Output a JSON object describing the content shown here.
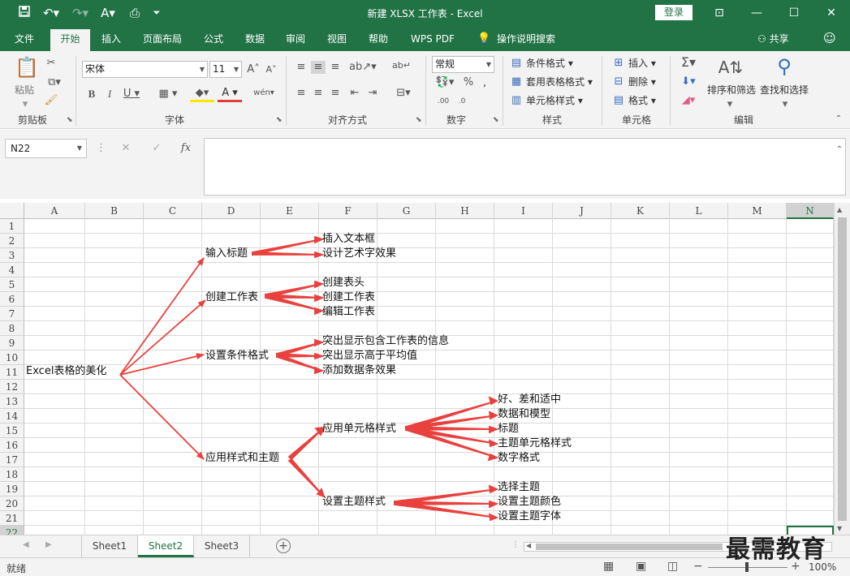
{
  "titlebar": {
    "title": "新建 XLSX 工作表 - Excel",
    "login": "登录",
    "save_icon": "save-icon",
    "undo_icon": "undo-icon",
    "redo_icon": "redo-icon"
  },
  "tabs": [
    "文件",
    "开始",
    "插入",
    "页面布局",
    "公式",
    "数据",
    "审阅",
    "视图",
    "帮助",
    "WPS PDF",
    "操作说明搜索"
  ],
  "share": "共享",
  "ribbon": {
    "clipboard": {
      "label": "剪贴板",
      "paste": "粘贴"
    },
    "font": {
      "label": "字体",
      "name": "宋体",
      "size": "11"
    },
    "alignment": {
      "label": "对齐方式"
    },
    "number": {
      "label": "数字",
      "format": "常规"
    },
    "styles": {
      "label": "样式",
      "conditional": "条件格式",
      "table": "套用表格格式",
      "cell": "单元格样式"
    },
    "cells": {
      "label": "单元格",
      "insert": "插入",
      "delete": "删除",
      "format": "格式"
    },
    "editing": {
      "label": "编辑",
      "sort": "排序和筛选",
      "find": "查找和选择"
    }
  },
  "formula": {
    "namebox": "N22",
    "fx": "fx",
    "value": ""
  },
  "columns": [
    "A",
    "B",
    "C",
    "D",
    "E",
    "F",
    "G",
    "H",
    "I",
    "J",
    "K",
    "L",
    "M",
    "N"
  ],
  "rows": [
    "1",
    "2",
    "3",
    "4",
    "5",
    "6",
    "7",
    "8",
    "9",
    "10",
    "11",
    "12",
    "13",
    "14",
    "15",
    "16",
    "17",
    "18",
    "19",
    "20",
    "21",
    "22"
  ],
  "mindmap": {
    "root": "Excel表格的美化",
    "level1": [
      "输入标题",
      "创建工作表",
      "设置条件格式",
      "应用样式和主题"
    ],
    "level2": [
      "应用单元格样式",
      "设置主题样式"
    ],
    "leaves": [
      "插入文本框",
      "设计艺术字效果",
      "创建表头",
      "创建工作表",
      "编辑工作表",
      "突出显示包含工作表的信息",
      "突出显示高于平均值",
      "添加数据条效果",
      "好、差和适中",
      "数据和模型",
      "标题",
      "主题单元格样式",
      "数字格式",
      "选择主题",
      "设置主题颜色",
      "设置主题字体"
    ]
  },
  "sheets": [
    "Sheet1",
    "Sheet2",
    "Sheet3"
  ],
  "active_sheet": "Sheet2",
  "status": {
    "ready": "就绪",
    "zoom": "100%"
  },
  "watermark": "最需教育",
  "colors": {
    "accent": "#217346",
    "arrow": "#e8413e"
  }
}
